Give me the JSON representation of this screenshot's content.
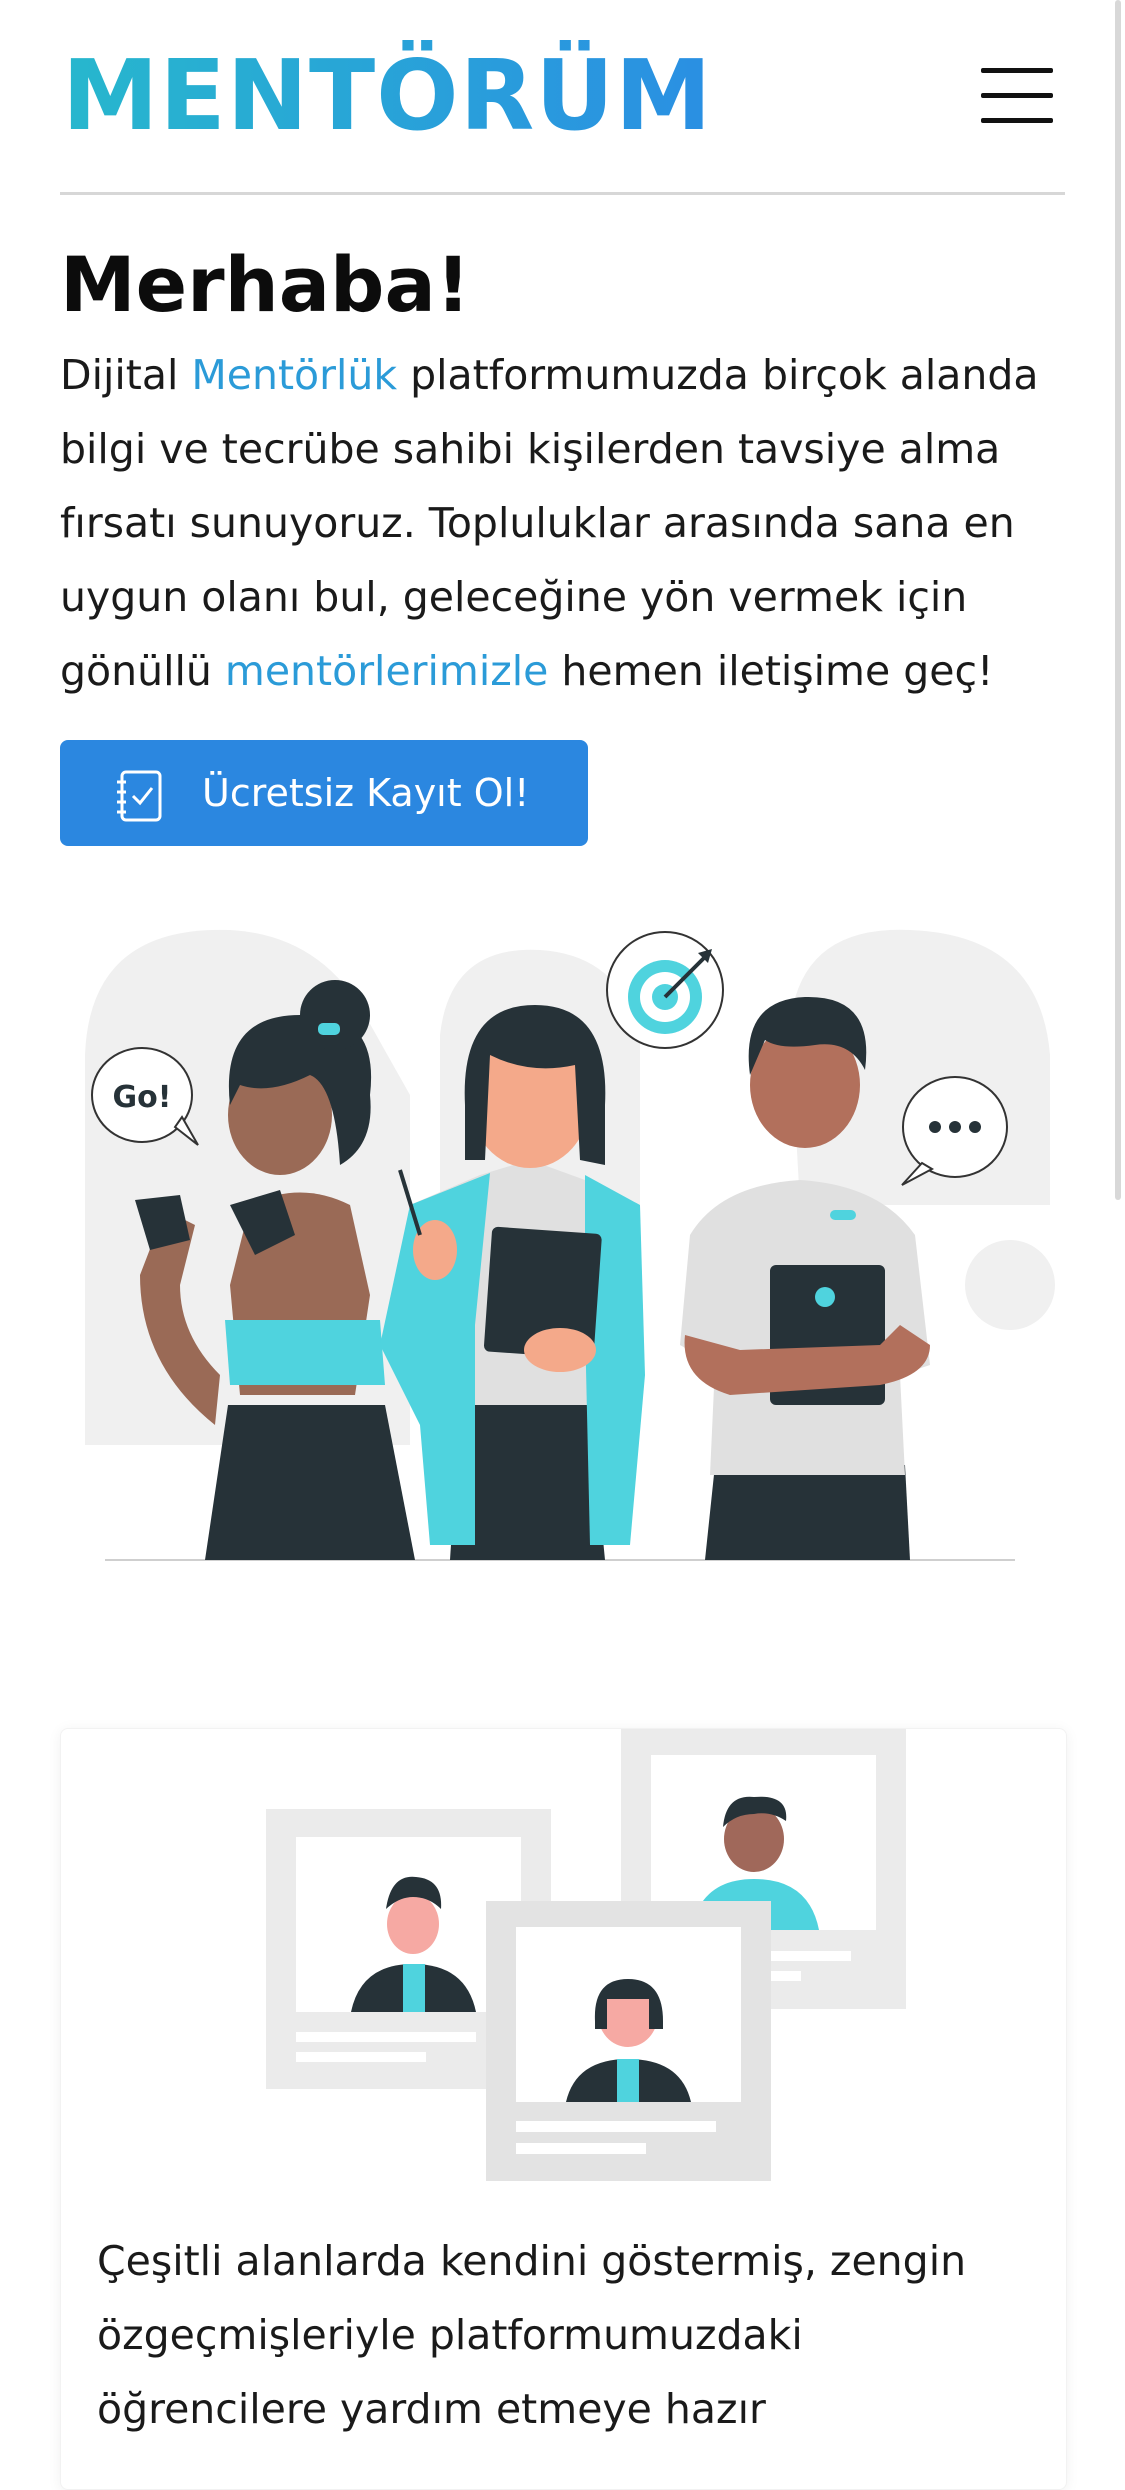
{
  "header": {
    "logo": "MENTÖRÜM",
    "menu_icon": "hamburger-menu-icon"
  },
  "hero": {
    "title": "Merhaba!",
    "intro_parts": [
      "Dijital ",
      "Mentörlük",
      " platformumuzda birçok alanda bilgi ve tecrübe sahibi kişilerden tavsiye alma fırsatı sunuyoruz. Topluluklar arasında sana en uygun olanı bul, geleceğine yön vermek için gönüllü ",
      "mentörlerimizle",
      " hemen iletişime geç!"
    ],
    "cta_label": "Ücretsiz Kayıt Ol!",
    "cta_icon": "checklist-notebook-icon",
    "illustration": {
      "bubble_left": "Go!",
      "bubble_right": "•••"
    }
  },
  "feature_card": {
    "text": "Çeşitli alanlarda kendini göstermiş, zengin özgeçmişleriyle platformumuzdaki öğrencilere yardım etmeye hazır"
  },
  "colors": {
    "brand_gradient_start": "#27b7cd",
    "brand_gradient_end": "#2a8fe3",
    "accent_text": "#2b9bd8",
    "cta_background": "#2b87e0",
    "illustration_teal": "#4fd3de"
  }
}
